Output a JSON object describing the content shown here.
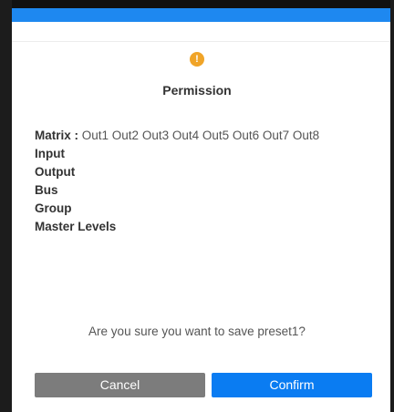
{
  "dialog": {
    "icon": "warning-icon",
    "icon_glyph": "!",
    "title": "Permission",
    "matrix_label": "Matrix :",
    "matrix_outputs": "Out1 Out2 Out3 Out4 Out5 Out6 Out7 Out8",
    "permissions": [
      "Input",
      "Output",
      "Bus",
      "Group",
      "Master Levels"
    ],
    "question": "Are you sure you want to save preset1?",
    "cancel_label": "Cancel",
    "confirm_label": "Confirm"
  },
  "colors": {
    "title_bar": "#1e88f0",
    "warning": "#f0a428",
    "cancel": "#7c7c7c",
    "confirm": "#0a7cf2"
  }
}
